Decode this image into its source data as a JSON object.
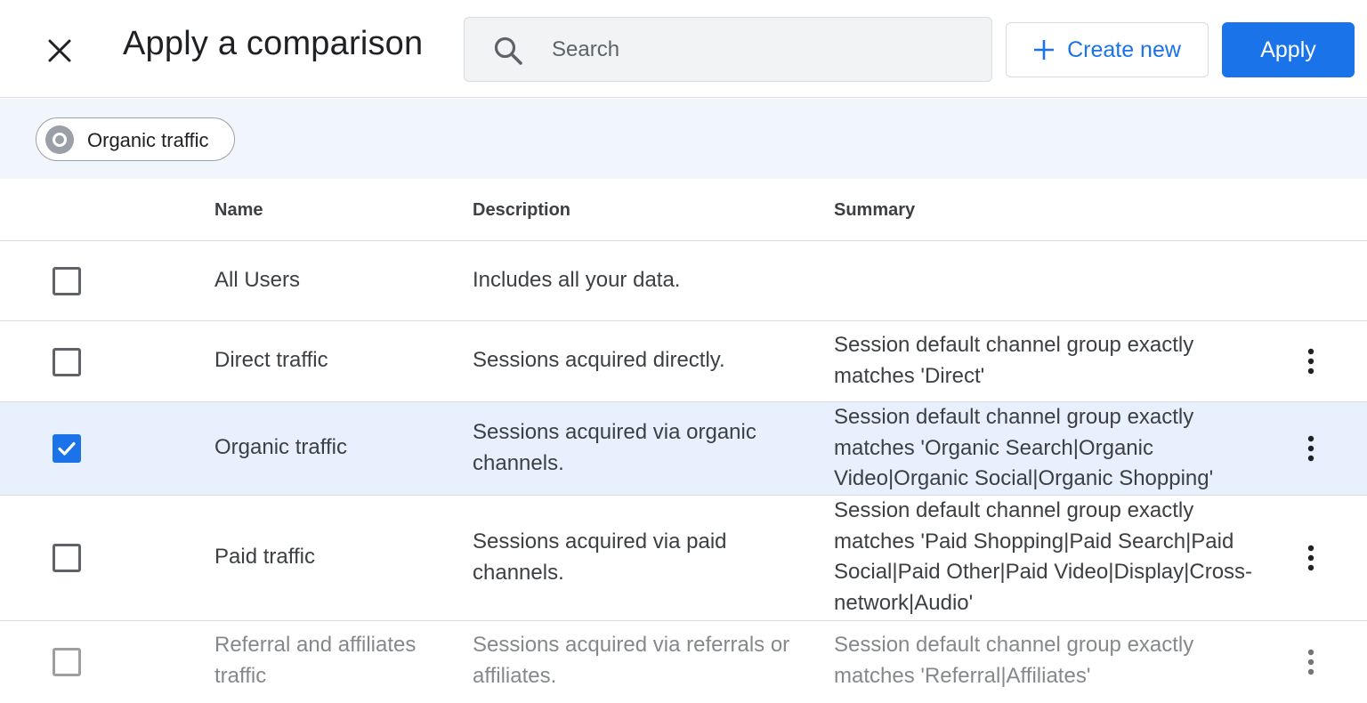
{
  "header": {
    "title": "Apply a comparison",
    "search_placeholder": "Search",
    "create_label": "Create new",
    "apply_label": "Apply"
  },
  "selected_chips": [
    {
      "label": "Organic traffic"
    }
  ],
  "table": {
    "columns": [
      "Name",
      "Description",
      "Summary"
    ],
    "rows": [
      {
        "name": "All Users",
        "description": "Includes all your data.",
        "summary": "",
        "checked": false
      },
      {
        "name": "Direct traffic",
        "description": "Sessions acquired directly.",
        "summary": "Session default channel group exactly matches 'Direct'",
        "checked": false
      },
      {
        "name": "Organic traffic",
        "description": "Sessions acquired via organic channels.",
        "summary": "Session default channel group exactly matches 'Organic Search|Organic Video|Organic Social|Organic Shopping'",
        "checked": true
      },
      {
        "name": "Paid traffic",
        "description": "Sessions acquired via paid channels.",
        "summary": "Session default channel group exactly matches 'Paid Shopping|Paid Search|Paid Social|Paid Other|Paid Video|Display|Cross-network|Audio'",
        "checked": false
      },
      {
        "name": "Referral and affiliates traffic",
        "description": "Sessions acquired via referrals or affiliates.",
        "summary": "Session default channel group exactly matches 'Referral|Affiliates'",
        "checked": false
      }
    ]
  },
  "colors": {
    "accent": "#1a73e8",
    "selected_row": "#e8f0fe",
    "chip_band": "#f1f6fc"
  },
  "icons": {
    "close": "close-icon",
    "search": "search-icon",
    "create": "plus-icon",
    "more": "more-vert-icon",
    "check": "check-icon"
  }
}
